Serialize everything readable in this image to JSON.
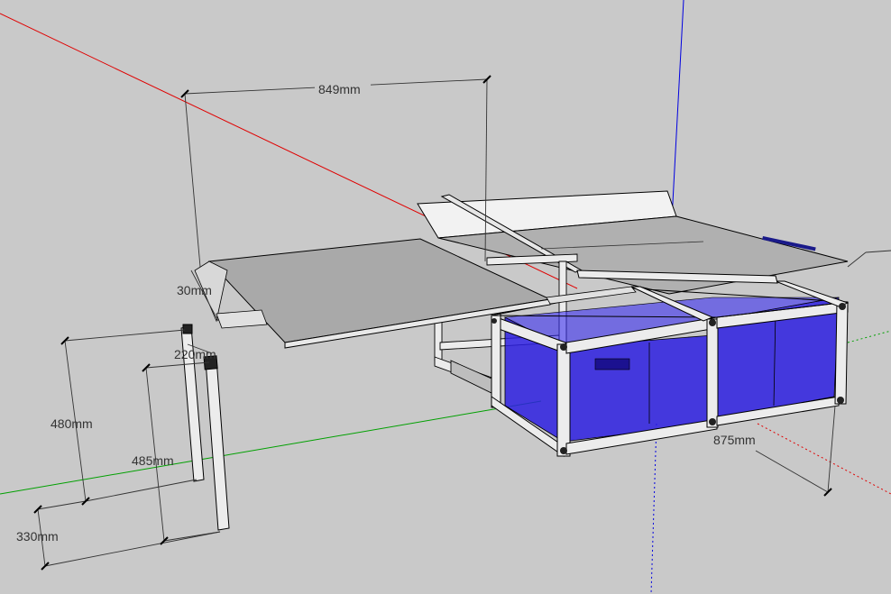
{
  "model": {
    "dimensions": [
      {
        "id": "width-849",
        "text": "849mm"
      },
      {
        "id": "thickness-30",
        "text": "30mm"
      },
      {
        "id": "offset-220",
        "text": "220mm"
      },
      {
        "id": "height-480",
        "text": "480mm"
      },
      {
        "id": "height-485",
        "text": "485mm"
      },
      {
        "id": "depth-330",
        "text": "330mm"
      },
      {
        "id": "depth-875",
        "text": "875mm"
      }
    ],
    "colors": {
      "background": "#c9c9c9",
      "x_axis": "#e00000",
      "y_axis": "#00a000",
      "z_axis": "#0000e0",
      "crate_fill": "#2d1ee0",
      "frame": "#ececec",
      "panel": "#ababab",
      "edge": "#000000"
    }
  }
}
